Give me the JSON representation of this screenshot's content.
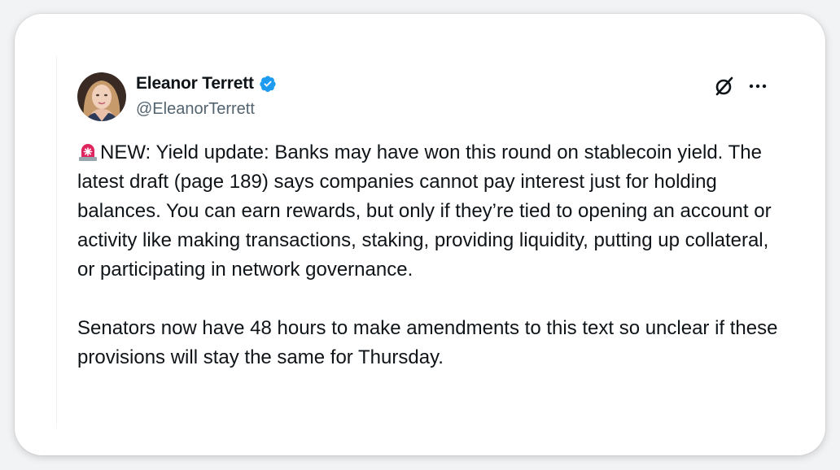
{
  "author": {
    "name": "Eleanor Terrett",
    "handle": "@EleanorTerrett",
    "verified": true
  },
  "icons": {
    "verified": "verified-badge-icon",
    "x_logo": "x-logo-icon",
    "more": "more-options-icon",
    "siren": "rotating-light-emoji"
  },
  "tweet": {
    "paragraphs": [
      "NEW: Yield update: Banks may have won this round on stablecoin yield. The latest draft (page 189) says companies cannot pay interest just for holding balances. You can earn rewards, but only if they’re tied to opening an account or activity like making transactions, staking, providing liquidity, putting up collateral, or participating in network governance.",
      "Senators now have 48 hours to make amendments to this text so unclear if these provisions will stay the same for Thursday."
    ]
  },
  "colors": {
    "text": "#0f1419",
    "secondary": "#536471",
    "verified_blue": "#1d9bf0",
    "siren_red": "#e0245e"
  }
}
